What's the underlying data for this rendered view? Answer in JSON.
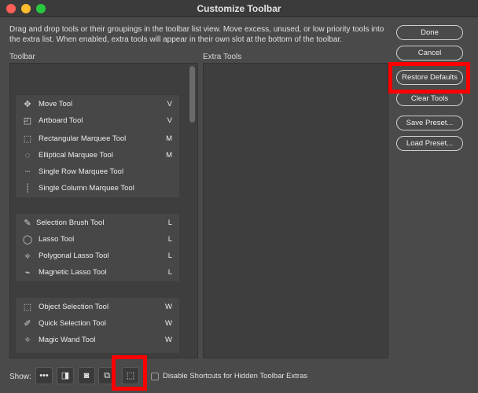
{
  "window": {
    "title": "Customize Toolbar"
  },
  "description": "Drag and drop tools or their groupings in the toolbar list view. Move excess, unused, or low priority tools into the extra list. When enabled, extra tools will appear in their own slot at the bottom of the toolbar.",
  "toolbar_label": "Toolbar",
  "extra_label": "Extra Tools",
  "groups": [
    {
      "tools": [
        {
          "name": "Move Tool",
          "key": "V",
          "icon": "move-icon"
        },
        {
          "name": "Artboard Tool",
          "key": "V",
          "icon": "artboard-icon"
        }
      ]
    },
    {
      "tools": [
        {
          "name": "Rectangular Marquee Tool",
          "key": "M",
          "icon": "rect-marquee-icon"
        },
        {
          "name": "Elliptical Marquee Tool",
          "key": "M",
          "icon": "ellipse-marquee-icon"
        },
        {
          "name": "Single Row Marquee Tool",
          "key": "",
          "icon": "row-marquee-icon"
        },
        {
          "name": "Single Column Marquee Tool",
          "key": "",
          "icon": "column-marquee-icon"
        }
      ]
    },
    {
      "tools": [
        {
          "name": "Selection Brush Tool",
          "key": "L",
          "icon": "selection-brush-icon"
        },
        {
          "name": "Lasso Tool",
          "key": "L",
          "icon": "lasso-icon"
        },
        {
          "name": "Polygonal Lasso Tool",
          "key": "L",
          "icon": "polygonal-lasso-icon"
        },
        {
          "name": "Magnetic Lasso Tool",
          "key": "L",
          "icon": "magnetic-lasso-icon"
        }
      ]
    },
    {
      "tools": [
        {
          "name": "Object Selection Tool",
          "key": "W",
          "icon": "object-selection-icon"
        },
        {
          "name": "Quick Selection Tool",
          "key": "W",
          "icon": "quick-selection-icon"
        },
        {
          "name": "Magic Wand Tool",
          "key": "W",
          "icon": "magic-wand-icon"
        }
      ]
    }
  ],
  "buttons": {
    "done": "Done",
    "cancel": "Cancel",
    "restore": "Restore Defaults",
    "clear": "Clear Tools",
    "save": "Save Preset...",
    "load": "Load Preset..."
  },
  "show": {
    "label": "Show:",
    "more_glyph": "•••",
    "checkbox_label": "Disable Shortcuts for Hidden Toolbar Extras",
    "checkbox_checked": false
  },
  "colors": {
    "highlight": "#ff0000",
    "background": "#4a4a4a",
    "panel": "#3e3e3e"
  }
}
